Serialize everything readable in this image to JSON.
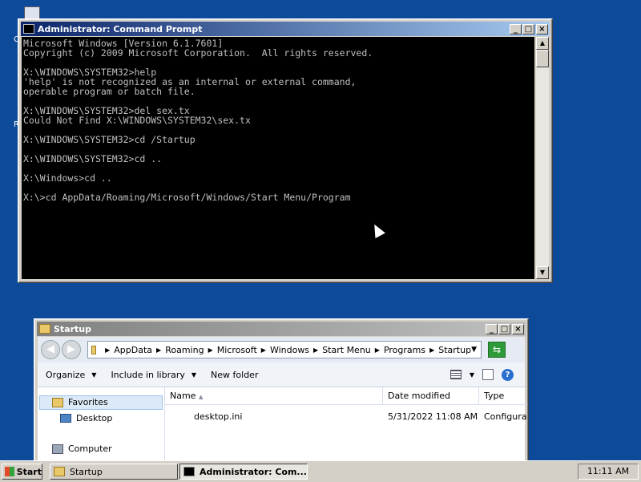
{
  "desktop": {
    "icons": [
      "computer-icon"
    ]
  },
  "cmd_window": {
    "title": "Administrator: Command Prompt",
    "lines": [
      "Microsoft Windows [Version 6.1.7601]",
      "Copyright (c) 2009 Microsoft Corporation.  All rights reserved.",
      "",
      "X:\\WINDOWS\\SYSTEM32>help",
      "'help' is not recognized as an internal or external command,",
      "operable program or batch file.",
      "",
      "X:\\WINDOWS\\SYSTEM32>del sex.tx",
      "Could Not Find X:\\WINDOWS\\SYSTEM32\\sex.tx",
      "",
      "X:\\WINDOWS\\SYSTEM32>cd /Startup",
      "",
      "X:\\WINDOWS\\SYSTEM32>cd ..",
      "",
      "X:\\Windows>cd ..",
      "",
      "X:\\>cd AppData/Roaming/Microsoft/Windows/Start Menu/Program"
    ]
  },
  "explorer_window": {
    "title": "Startup",
    "breadcrumb": [
      "AppData",
      "Roaming",
      "Microsoft",
      "Windows",
      "Start Menu",
      "Programs",
      "Startup"
    ],
    "toolbar": {
      "organize": "Organize",
      "include": "Include in library",
      "new_folder": "New folder"
    },
    "nav": {
      "favorites": "Favorites",
      "desktop": "Desktop",
      "computer": "Computer"
    },
    "columns": {
      "name": "Name",
      "date": "Date modified",
      "type": "Type"
    },
    "files": [
      {
        "name": "desktop.ini",
        "date": "5/31/2022 11:08 AM",
        "type": "Configuration settings"
      }
    ]
  },
  "taskbar": {
    "start": "Start",
    "tasks": [
      "Startup",
      "Administrator: Com..."
    ],
    "clock": "11:11 AM"
  },
  "colors": {
    "desktop": "#0d4a9a",
    "console_bg": "#000000",
    "console_fg": "#c0c0c0",
    "active_title": "#0a246a"
  }
}
